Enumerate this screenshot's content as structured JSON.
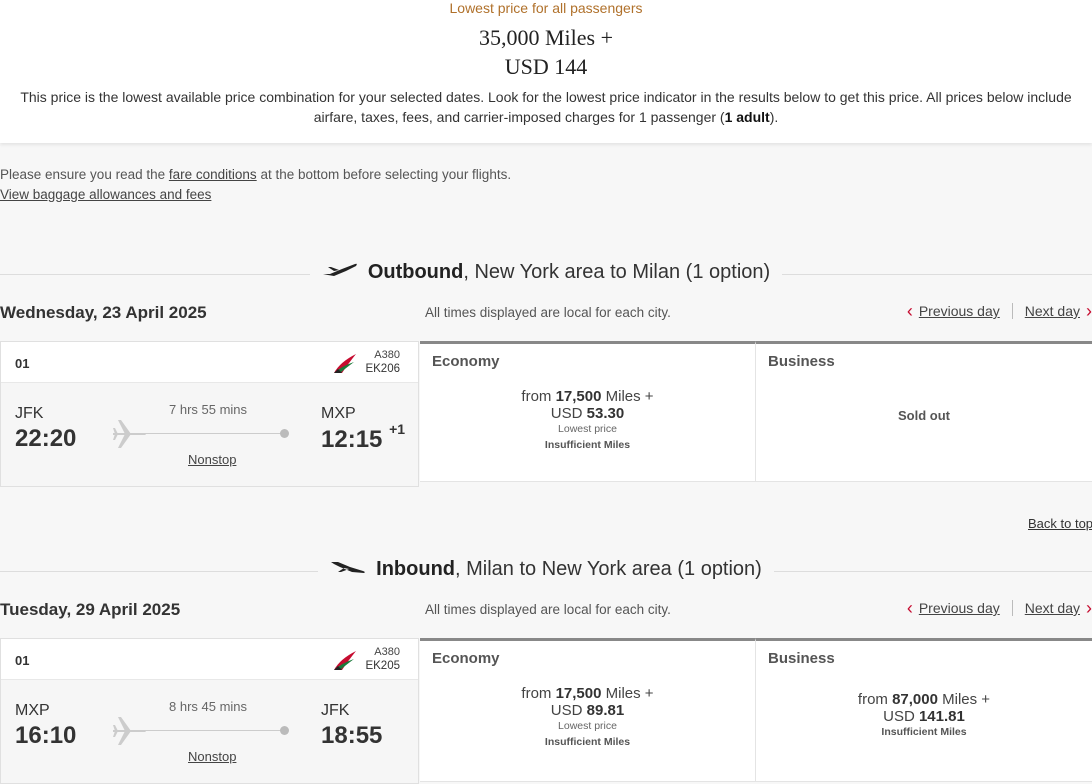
{
  "summary": {
    "label": "Lowest price for all passengers",
    "miles": "35,000 Miles +",
    "usd": "USD 144",
    "desc_part1": "This price is the lowest available price combination for your selected dates. Look for the lowest price indicator in the results below to get this price. All prices below include airfare, taxes, fees, and carrier-imposed charges for 1 passenger (",
    "desc_bold": "1 adult",
    "desc_part2": ")."
  },
  "notice": {
    "prefix": "Please ensure you read the ",
    "link": "fare conditions",
    "suffix": " at the bottom before selecting your flights.",
    "baggage_link": "View baggage allowances and fees"
  },
  "common": {
    "tz_note": "All times displayed are local for each city.",
    "prev_day": "Previous day",
    "next_day": "Next day",
    "back_to_top": "Back to top",
    "economy": "Economy",
    "business": "Business",
    "nonstop": "Nonstop",
    "lowest_price": "Lowest price",
    "insufficient": "Insufficient Miles",
    "sold_out": "Sold out",
    "from": "from",
    "miles_plus": " Miles +",
    "usd_prefix": "USD "
  },
  "outbound": {
    "title_bold": "Outbound",
    "title_rest": ", New York area to Milan (1 option)",
    "date": "Wednesday, 23 April 2025",
    "flight": {
      "index": "01",
      "aircraft": "A380",
      "flight_no": "EK206",
      "from_code": "JFK",
      "from_time": "22:20",
      "duration": "7 hrs 55 mins",
      "to_code": "MXP",
      "to_time": "12:15",
      "day_offset": "+1"
    },
    "economy": {
      "miles": "17,500",
      "usd": "53.30"
    }
  },
  "inbound": {
    "title_bold": "Inbound",
    "title_rest": ", Milan to New York area (1 option)",
    "date": "Tuesday, 29 April 2025",
    "flight": {
      "index": "01",
      "aircraft": "A380",
      "flight_no": "EK205",
      "from_code": "MXP",
      "from_time": "16:10",
      "duration": "8 hrs 45 mins",
      "to_code": "JFK",
      "to_time": "18:55"
    },
    "economy": {
      "miles": "17,500",
      "usd": "89.81"
    },
    "business": {
      "miles": "87,000",
      "usd": "141.81"
    }
  },
  "colors": {
    "accent_red": "#c60c30",
    "lowest_label": "#b0712b"
  },
  "icons": [
    "plane-takeoff-icon",
    "plane-landing-icon",
    "chevron-left-icon",
    "chevron-right-icon",
    "emirates-logo",
    "plane-icon"
  ]
}
